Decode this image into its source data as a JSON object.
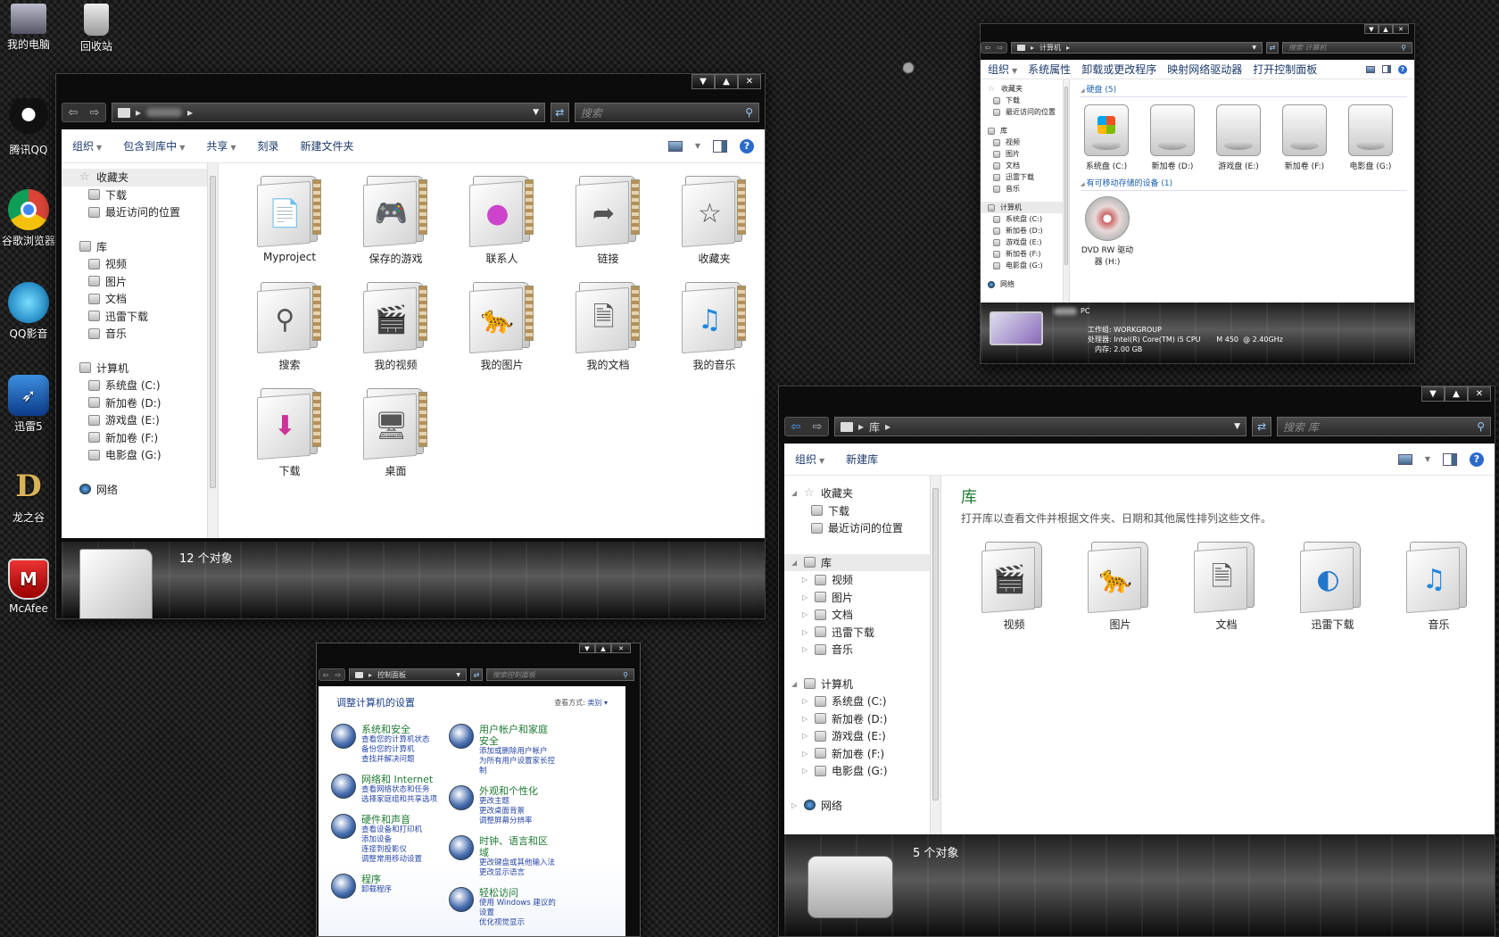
{
  "desktop": {
    "icons": [
      {
        "label": "我的电脑"
      },
      {
        "label": "回收站"
      },
      {
        "label": "腾讯QQ"
      },
      {
        "label": "谷歌浏览器"
      },
      {
        "label": "QQ影音"
      },
      {
        "label": "迅雷5"
      },
      {
        "label": "龙之谷"
      },
      {
        "label": "McAfee"
      }
    ]
  },
  "win1": {
    "search_placeholder": "搜索",
    "toolbar": {
      "organize": "组织",
      "include": "包含到库中",
      "share": "共享",
      "burn": "刻录",
      "new_folder": "新建文件夹"
    },
    "nav": {
      "favorites": "收藏夹",
      "downloads": "下载",
      "recent": "最近访问的位置",
      "libraries": "库",
      "videos": "视频",
      "pictures": "图片",
      "docs": "文档",
      "thunder": "迅雷下载",
      "music": "音乐",
      "computer": "计算机",
      "c": "系统盘 (C:)",
      "d": "新加卷 (D:)",
      "e": "游戏盘 (E:)",
      "f": "新加卷 (F:)",
      "g": "电影盘 (G:)",
      "network": "网络"
    },
    "items": [
      "Myproject",
      "保存的游戏",
      "联系人",
      "链接",
      "收藏夹",
      "搜索",
      "我的视频",
      "我的图片",
      "我的文档",
      "我的音乐",
      "下载",
      "桌面"
    ],
    "status": "12 个对象"
  },
  "win2": {
    "address": "计算机",
    "search_placeholder": "搜索 计算机",
    "toolbar": {
      "organize": "组织",
      "props": "系统属性",
      "uninstall": "卸载或更改程序",
      "map": "映射网络驱动器",
      "control": "打开控制面板"
    },
    "nav": {
      "favorites": "收藏夹",
      "downloads": "下载",
      "recent": "最近访问的位置",
      "libraries": "库",
      "videos": "视频",
      "pictures": "图片",
      "docs": "文档",
      "thunder": "迅雷下载",
      "music": "音乐",
      "computer": "计算机",
      "c": "系统盘 (C:)",
      "d": "新加卷 (D:)",
      "e": "游戏盘 (E:)",
      "f": "新加卷 (F:)",
      "g": "电影盘 (G:)",
      "network": "网络"
    },
    "group_hdd": "硬盘 (5)",
    "drives": [
      "系统盘 (C:)",
      "新加卷 (D:)",
      "游戏盘 (E:)",
      "新加卷 (F:)",
      "电影盘 (G:)"
    ],
    "group_removable": "有可移动存储的设备 (1)",
    "dvd": "DVD RW 驱动器 (H:)",
    "pc_name": "PC",
    "workgroup": "工作组: WORKGROUP",
    "cpu": "处理器: Intel(R) Core(TM) i5 CPU       M 450  @ 2.40GHz",
    "ram": "内存: 2.00 GB"
  },
  "win3": {
    "address": "库",
    "search_placeholder": "搜索 库",
    "toolbar": {
      "organize": "组织",
      "new_lib": "新建库"
    },
    "nav": {
      "favorites": "收藏夹",
      "downloads": "下载",
      "recent": "最近访问的位置",
      "libraries": "库",
      "videos": "视频",
      "pictures": "图片",
      "docs": "文档",
      "thunder": "迅雷下载",
      "music": "音乐",
      "computer": "计算机",
      "c": "系统盘 (C:)",
      "d": "新加卷 (D:)",
      "e": "游戏盘 (E:)",
      "f": "新加卷 (F:)",
      "g": "电影盘 (G:)",
      "network": "网络"
    },
    "heading": "库",
    "subtitle": "打开库以查看文件并根据文件夹、日期和其他属性排列这些文件。",
    "items": [
      "视频",
      "图片",
      "文档",
      "迅雷下载",
      "音乐"
    ],
    "status": "5 个对象"
  },
  "win4": {
    "address": "控制面板",
    "search_placeholder": "搜索控制面板",
    "title": "调整计算机的设置",
    "view_label": "查看方式:",
    "view_value": "类别",
    "left": [
      {
        "title": "系统和安全",
        "links": [
          "查看您的计算机状态",
          "备份您的计算机",
          "查找并解决问题"
        ]
      },
      {
        "title": "网络和 Internet",
        "links": [
          "查看网络状态和任务",
          "选择家庭组和共享选项"
        ]
      },
      {
        "title": "硬件和声音",
        "links": [
          "查看设备和打印机",
          "添加设备",
          "连接到投影仪",
          "调整常用移动设置"
        ]
      },
      {
        "title": "程序",
        "links": [
          "卸载程序"
        ]
      }
    ],
    "right": [
      {
        "title": "用户帐户和家庭安全",
        "links": [
          "添加或删除用户帐户",
          "为所有用户设置家长控制"
        ]
      },
      {
        "title": "外观和个性化",
        "links": [
          "更改主题",
          "更改桌面背景",
          "调整屏幕分辨率"
        ]
      },
      {
        "title": "时钟、语言和区域",
        "links": [
          "更改键盘或其他输入法",
          "更改显示语言"
        ]
      },
      {
        "title": "轻松访问",
        "links": [
          "使用 Windows 建议的设置",
          "优化视觉显示"
        ]
      }
    ]
  }
}
